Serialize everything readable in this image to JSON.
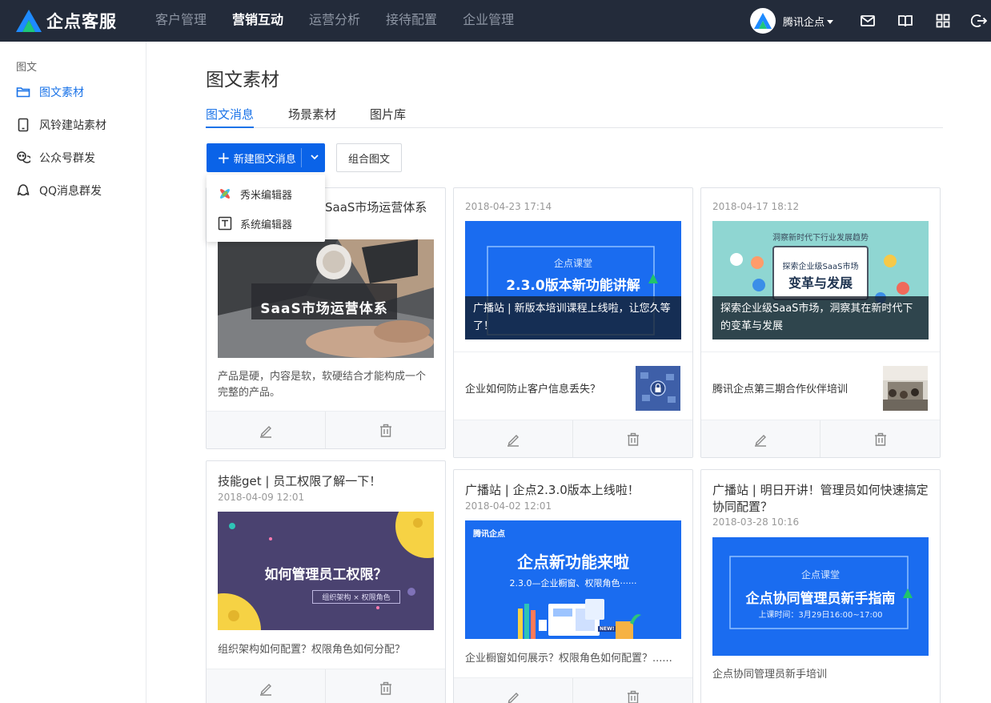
{
  "app": {
    "name": "企点客服"
  },
  "nav": {
    "items": [
      {
        "label": "客户管理",
        "active": false
      },
      {
        "label": "营销互动",
        "active": true
      },
      {
        "label": "运营分析",
        "active": false
      },
      {
        "label": "接待配置",
        "active": false
      },
      {
        "label": "企业管理",
        "active": false
      }
    ]
  },
  "user": {
    "name": "腾讯企点"
  },
  "header_icons": [
    "mail-icon",
    "book-icon",
    "apps-grid-icon",
    "logout-icon"
  ],
  "sidebar": {
    "section": "图文",
    "items": [
      {
        "label": "图文素材",
        "icon": "folder-icon",
        "active": true
      },
      {
        "label": "风铃建站素材",
        "icon": "tablet-icon",
        "active": false
      },
      {
        "label": "公众号群发",
        "icon": "wechat-broadcast-icon",
        "active": false
      },
      {
        "label": "QQ消息群发",
        "icon": "qq-broadcast-icon",
        "active": false
      }
    ]
  },
  "page": {
    "title": "图文素材"
  },
  "tabs": [
    {
      "label": "图文消息",
      "active": true
    },
    {
      "label": "场景素材",
      "active": false
    },
    {
      "label": "图片库",
      "active": false
    }
  ],
  "toolbar": {
    "new_label": "新建图文消息",
    "combo_label": "组合图文"
  },
  "dropdown": {
    "items": [
      {
        "label": "秀米编辑器",
        "icon": "xiumi-icon"
      },
      {
        "label": "系统编辑器",
        "icon": "text-editor-icon"
      }
    ]
  },
  "colors": {
    "topbar": "#232b3a",
    "accent": "#0a63e8",
    "active_link": "#1a73e8"
  },
  "cards": [
    {
      "title": "SaaS市场运营体系",
      "cover_text": "SaaS市场运营体系",
      "desc_lines": [
        "产品是硬，内容是软，软硬结合才能构成一个",
        "完整的产品。"
      ]
    },
    {
      "date": "2018-04-23 17:14",
      "cover_lines": [
        "企点课堂",
        "2.3.0版本新功能讲解"
      ],
      "caption": "广播站 | 新版本培训课程上线啦，让您久等了！",
      "sub": "企业如何防止客户信息丢失？"
    },
    {
      "date": "2018-04-17 18:12",
      "cover_lines": [
        "洞察新时代下行业发展趋势",
        "探索企业级SaaS市场",
        "变革与发展"
      ],
      "caption": "探索企业级SaaS市场，洞察其在新时代下的变革与发展",
      "sub": "腾讯企点第三期合作伙伴培训"
    },
    {
      "title": "技能get | 员工权限了解一下！",
      "date": "2018-04-09 12:01",
      "cover_lines": [
        "如何管理员工权限？",
        "组织架构 × 权限角色"
      ],
      "desc": "组织架构如何配置？权限角色如何分配？"
    },
    {
      "title": "广播站 | 企点2.3.0版本上线啦！",
      "date": "2018-04-02 12:01",
      "cover_lines": [
        "腾讯企点",
        "企点新功能来啦",
        "2.3.0—企业橱窗、权限角色······",
        "NEW!"
      ],
      "desc": "企业橱窗如何展示？权限角色如何配置？......"
    },
    {
      "title_lines": [
        "广播站 | 明日开讲！管理员如何快速搞定",
        "协同配置？"
      ],
      "date": "2018-03-28 10:16",
      "cover_lines": [
        "企点课堂",
        "企点协同管理员新手指南",
        "上课时间：3月29日16:00~17:00"
      ],
      "desc": "企点协同管理员新手培训"
    }
  ]
}
